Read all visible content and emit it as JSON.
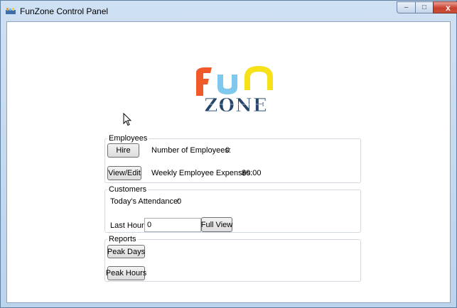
{
  "window": {
    "title": "FunZone Control Panel",
    "minimize_glyph": "–",
    "maximize_glyph": "□",
    "close_glyph": "x"
  },
  "logo": {
    "top_text": "Fun",
    "bottom_text": "ZONE",
    "colors": {
      "f": "#f0592a",
      "u": "#7fc8ee",
      "n": "#f7e119",
      "zone": "#25476b"
    }
  },
  "employees": {
    "legend": "Employees",
    "hire_label": "Hire",
    "count_label": "Number of Employees:",
    "count_value": "0",
    "view_edit_label": "View/Edit",
    "expenses_label": "Weekly Employee Expenses:",
    "expenses_value": "$0.00"
  },
  "customers": {
    "legend": "Customers",
    "attendance_label": "Today's Attendance:",
    "attendance_value": "0",
    "last_hour_label": "Last Hour:",
    "last_hour_value": "0",
    "full_view_label": "Full View"
  },
  "reports": {
    "legend": "Reports",
    "peak_days_label": "Peak Days",
    "peak_hours_label": "Peak Hours"
  }
}
